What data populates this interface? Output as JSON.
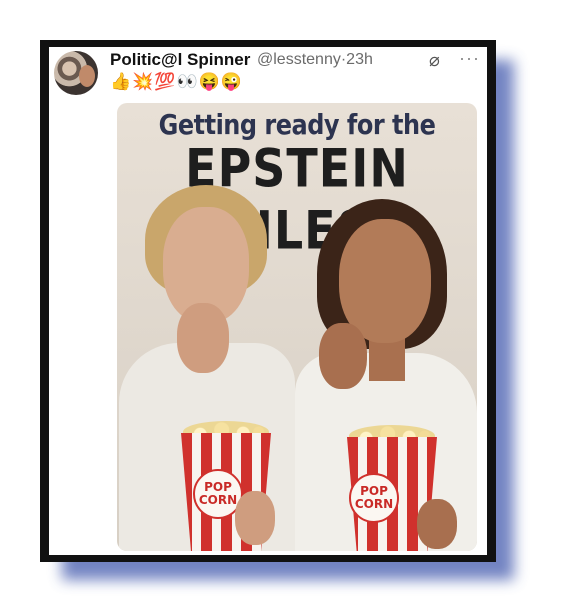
{
  "post": {
    "display_name": "Politic@l Spinner",
    "handle": "@lesstenny",
    "separator": "·",
    "time": "23h",
    "emojis": "👍💥💯👀😝😜",
    "grok_icon": "⌀",
    "more_icon": "···"
  },
  "media": {
    "headline_line1": "Getting ready for the",
    "headline_line2": "EPSTEIN FILES",
    "box_label_top": "POP",
    "box_label_bottom": "CORN"
  },
  "colors": {
    "shadow": "#5b6fb8",
    "frame": "#111111",
    "headline_top": "#2d3450",
    "popcorn_red": "#d0312d"
  }
}
